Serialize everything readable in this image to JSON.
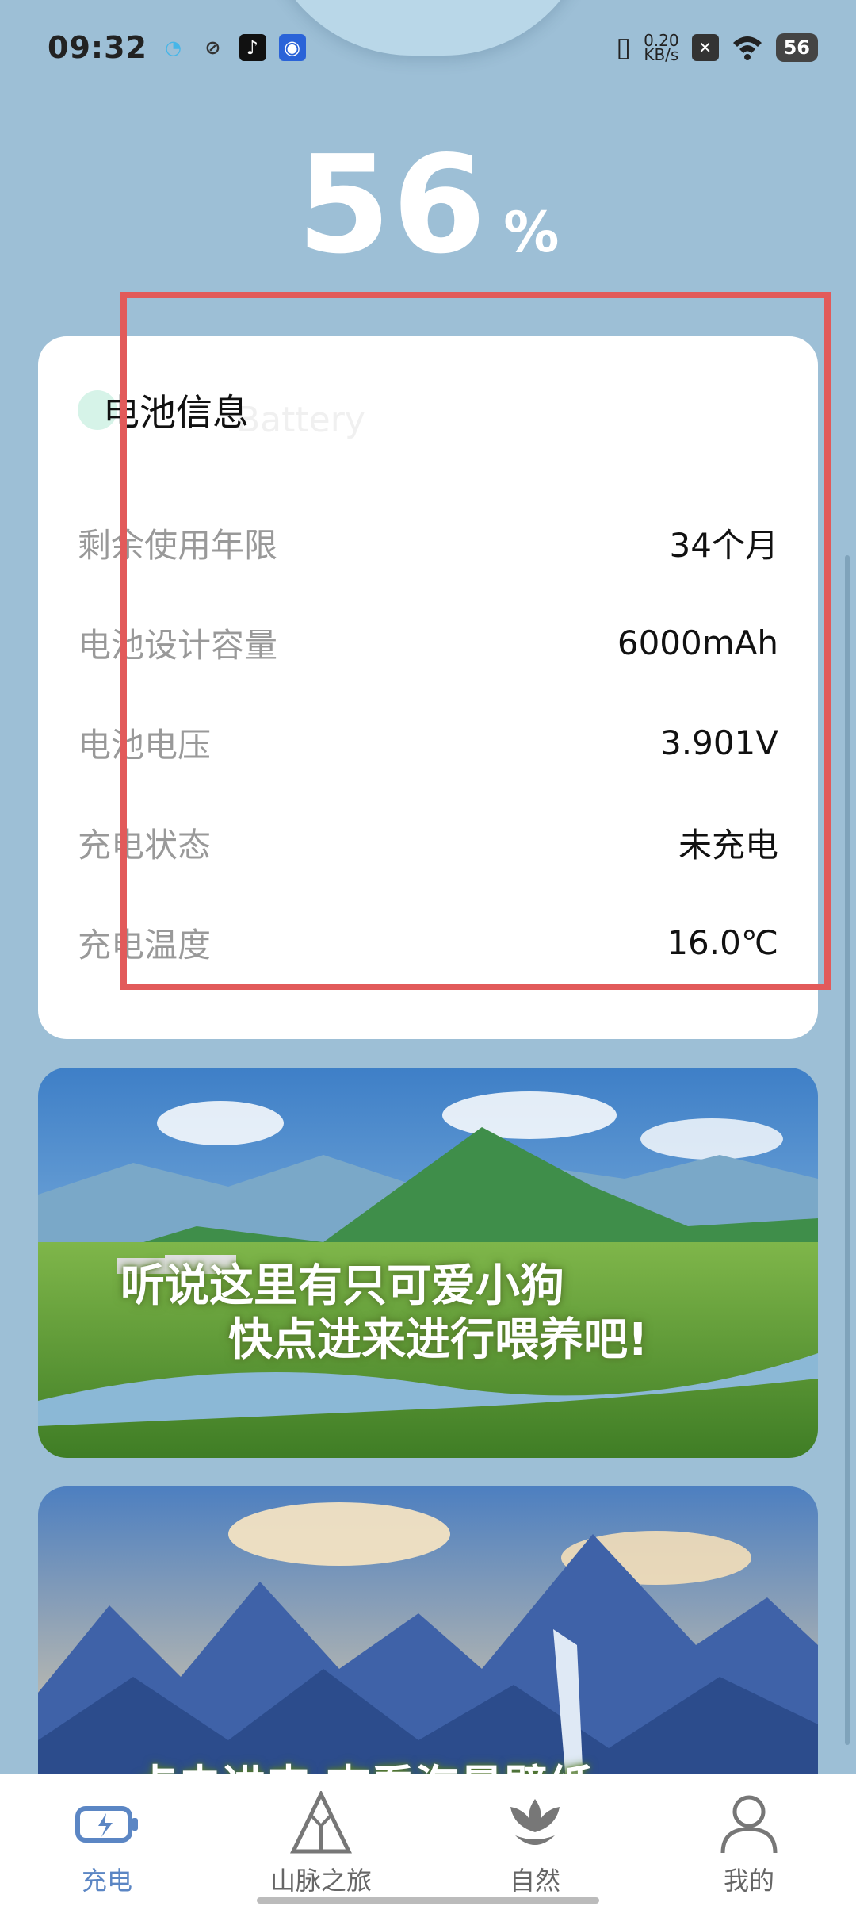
{
  "status_bar": {
    "time": "09:32",
    "net_speed_value": "0.20",
    "net_speed_unit": "KB/s",
    "battery_level": "56"
  },
  "battery": {
    "percent": "56",
    "percent_sign": "%"
  },
  "info_card": {
    "title": "电池信息",
    "watermark": "Battery",
    "rows": [
      {
        "label": "剩余使用年限",
        "value": "34个月"
      },
      {
        "label": "电池设计容量",
        "value": "6000mAh"
      },
      {
        "label": "电池电压",
        "value": "3.901V"
      },
      {
        "label": "充电状态",
        "value": "未充电"
      },
      {
        "label": "充电温度",
        "value": "16.0℃"
      }
    ]
  },
  "banners": [
    {
      "line1": "听说这里有只可爱小狗",
      "line2": "快点进来进行喂养吧!"
    },
    {
      "line1": "点击进来 查看海量壁纸"
    }
  ],
  "nav": {
    "items": [
      {
        "label": "充电",
        "icon": "battery-charge-icon",
        "active": true
      },
      {
        "label": "山脉之旅",
        "icon": "mountain-icon",
        "active": false
      },
      {
        "label": "自然",
        "icon": "flower-icon",
        "active": false
      },
      {
        "label": "我的",
        "icon": "user-icon",
        "active": false
      }
    ]
  },
  "colors": {
    "background": "#9dbfd6",
    "accent": "#5b86c4",
    "highlight": "#e25a5a"
  }
}
